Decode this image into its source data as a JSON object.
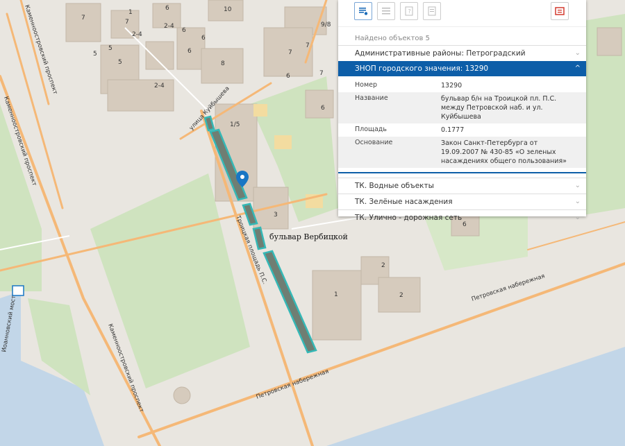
{
  "panel": {
    "found_text": "Найдено объектов 5",
    "rows": [
      {
        "label": "Административные районы: Петроградский"
      },
      {
        "label": "ЗНОП городского значения: 13290"
      },
      {
        "label": "ТК. Водные объекты"
      },
      {
        "label": "ТК. Зелёные насаждения"
      },
      {
        "label": "ТК. Улично - дорожная сеть"
      }
    ],
    "details": [
      {
        "label": "Номер",
        "value": "13290"
      },
      {
        "label": "Название",
        "value": "бульвар б/н на Троицкой пл. П.С. между Петровской наб. и ул. Куйбышева"
      },
      {
        "label": "Площадь",
        "value": "0.1777"
      },
      {
        "label": "Основание",
        "value": "Закон Санкт-Петербурга от 19.09.2007 № 430-85 «О зеленых насаждениях общего пользования»"
      }
    ],
    "chevron_down": "⌄",
    "chevron_up": "^"
  },
  "map": {
    "streets": {
      "kuibysheva": "улица Куйбышева",
      "troitskaya": "Троицкая площадь П.С.",
      "kamennoostrovsky": "Каменноостровский проспект",
      "ioannovsky": "Иоанновский мост",
      "petrovskaya": "Петровская набережная"
    },
    "feature_label": "бульвар Вербицкой",
    "house_numbers": [
      "7",
      "7",
      "1",
      "6",
      "10",
      "9/8",
      "2-4",
      "2-4",
      "5",
      "5",
      "6",
      "6",
      "6",
      "5",
      "8",
      "7",
      "7",
      "7",
      "6",
      "2-4",
      "1/5",
      "3",
      "6",
      "6",
      "2",
      "2",
      "1",
      "2"
    ]
  },
  "colors": {
    "panel_active": "#0d5ea8",
    "park": "#cfe3bf",
    "building": "#d6cbbd",
    "road": "#f5b877",
    "water": "#c2d6e8",
    "highlight": "#35b8b6"
  }
}
